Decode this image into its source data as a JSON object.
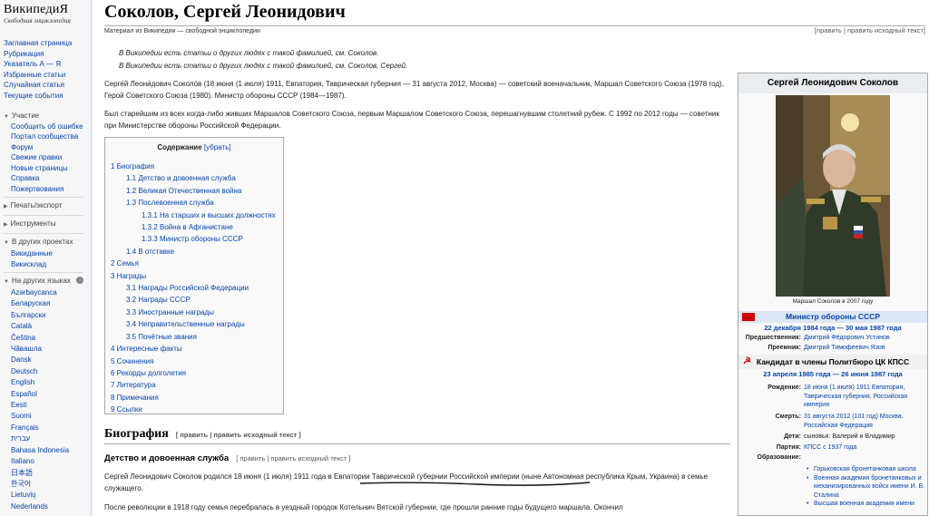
{
  "logo": {
    "title": "ВикипедиЯ",
    "subtitle": "Свободная энциклопедия"
  },
  "nav_main": [
    "Заглавная страница",
    "Рубрикация",
    "Указатель А — Я",
    "Избранные статьи",
    "Случайная статья",
    "Текущие события"
  ],
  "participation": {
    "label": "Участие",
    "items": [
      "Сообщить об ошибке",
      "Портал сообщества",
      "Форум",
      "Свежие правки",
      "Новые страницы",
      "Справка",
      "Пожертвования"
    ]
  },
  "print_label": "Печать/экспорт",
  "tools_label": "Инструменты",
  "other_projects": {
    "label": "В других проектах",
    "items": [
      "Викиданные",
      "Викисклад"
    ]
  },
  "languages": {
    "label": "На других языках",
    "items": [
      "Azərbaycanca",
      "Беларуская",
      "Български",
      "Català",
      "Čeština",
      "Чӑвашла",
      "Dansk",
      "Deutsch",
      "English",
      "Español",
      "Eesti",
      "Suomi",
      "Français",
      "עברית",
      "Bahasa Indonesia",
      "Italiano",
      "日本語",
      "한국어",
      "Lietuvių",
      "Nederlands"
    ]
  },
  "article": {
    "title": "Соколов, Сергей Леонидович",
    "tagline": "Материал из Википедии — свободной энциклопедии",
    "edit": "[править | править исходный текст]",
    "hatnote1": "В Википедии есть статьи о других людях с такой фамилией, см. Соколов.",
    "hatnote2": "В Википедии есть статьи о других людях с такой фамилией, см. Соколов, Сергей.",
    "lead": "Серге́й Леони́дович Соколо́в (18 июня (1 июля) 1911, Евпатория, Таврическая губерния — 31 августа 2012, Москва) — советский военачальник, Маршал Советского Союза (1978 год), Герой Советского Союза (1980). Министр обороны СССР (1984—1987).",
    "para2": "Был старейшим из всех когда-либо живших Маршалов Советского Союза, первым Маршалом Советского Союза, перешагнувшим столетний рубеж. С 1992 по 2012 годы — советник при Министерстве обороны Российской Федерации.",
    "toc": {
      "title": "Содержание",
      "toggle": "[убрать]",
      "items": [
        {
          "level": 1,
          "text": "1 Биография"
        },
        {
          "level": 2,
          "text": "1.1 Детство и довоенная служба"
        },
        {
          "level": 2,
          "text": "1.2 Великая Отечественная война"
        },
        {
          "level": 2,
          "text": "1.3 Послевоенная служба"
        },
        {
          "level": 3,
          "text": "1.3.1 На старших и высших должностях"
        },
        {
          "level": 3,
          "text": "1.3.2 Война в Афганистане"
        },
        {
          "level": 3,
          "text": "1.3.3 Министр обороны СССР"
        },
        {
          "level": 2,
          "text": "1.4 В отставке"
        },
        {
          "level": 1,
          "text": "2 Семья"
        },
        {
          "level": 1,
          "text": "3 Награды"
        },
        {
          "level": 2,
          "text": "3.1 Награды Российской Федерации"
        },
        {
          "level": 2,
          "text": "3.2 Награды СССР"
        },
        {
          "level": 2,
          "text": "3.3 Иностранные награды"
        },
        {
          "level": 2,
          "text": "3.4 Неправительственные награды"
        },
        {
          "level": 2,
          "text": "3.5 Почётные звания"
        },
        {
          "level": 1,
          "text": "4 Интересные факты"
        },
        {
          "level": 1,
          "text": "5 Сочинения"
        },
        {
          "level": 1,
          "text": "6 Рекорды долголетия"
        },
        {
          "level": 1,
          "text": "7 Литература"
        },
        {
          "level": 1,
          "text": "8 Примечания"
        },
        {
          "level": 1,
          "text": "9 Ссылки"
        }
      ]
    },
    "h2_bio": "Биография",
    "h2_edit": "[ править | править исходный текст ]",
    "h3_child": "Детство и довоенная служба",
    "h3_edit": "[ править | править исходный текст ]",
    "bio_p1": "Сергей Леонидович Соколов родился 18 июня (1 июля) 1911 года в Евпатории Таврической губернии Российской империи (ныне Автономная республика Крым, Украина) в семье служащего.",
    "bio_p2": "После революции в 1918 году семья перебралась в уездный городок Котельнич Вятской губернии, где прошли ранние годы будущего маршала. Окончил"
  },
  "infobox": {
    "title": "Сергей Леонидович Соколов",
    "caption": "Маршал Соколов в 2007 году",
    "post1": {
      "title": "Министр обороны СССР",
      "dates": "22 декабря 1984 года — 30 мая 1987 года",
      "pred_k": "Предшественник:",
      "pred_v": "Дмитрий Фёдорович Устинов",
      "succ_k": "Преемник:",
      "succ_v": "Дмитрий Тимофеевич Язов"
    },
    "post2": {
      "title": "Кандидат в члены Политбюро ЦК КПСС",
      "dates": "23 апреля 1985 года — 26 июня 1987 года"
    },
    "rows": [
      {
        "k": "Рождение:",
        "v": "18 июня (1 июля) 1911 Евпатория, Таврическая губерния, Российская империя"
      },
      {
        "k": "Смерть:",
        "v": "31 августа 2012 (101 год) Москва, Российская Федерация"
      },
      {
        "k": "Дети:",
        "v": "сыновья: Валерий и Владимир"
      },
      {
        "k": "Партия:",
        "v": "КПСС с 1937 года"
      },
      {
        "k": "Образование:",
        "v": ""
      }
    ],
    "education": [
      "Горьковская бронетанковая школа",
      "Военная академия бронетанковых и механизированных войск имени И. В. Сталина",
      "Высшая военная академия имени"
    ]
  }
}
